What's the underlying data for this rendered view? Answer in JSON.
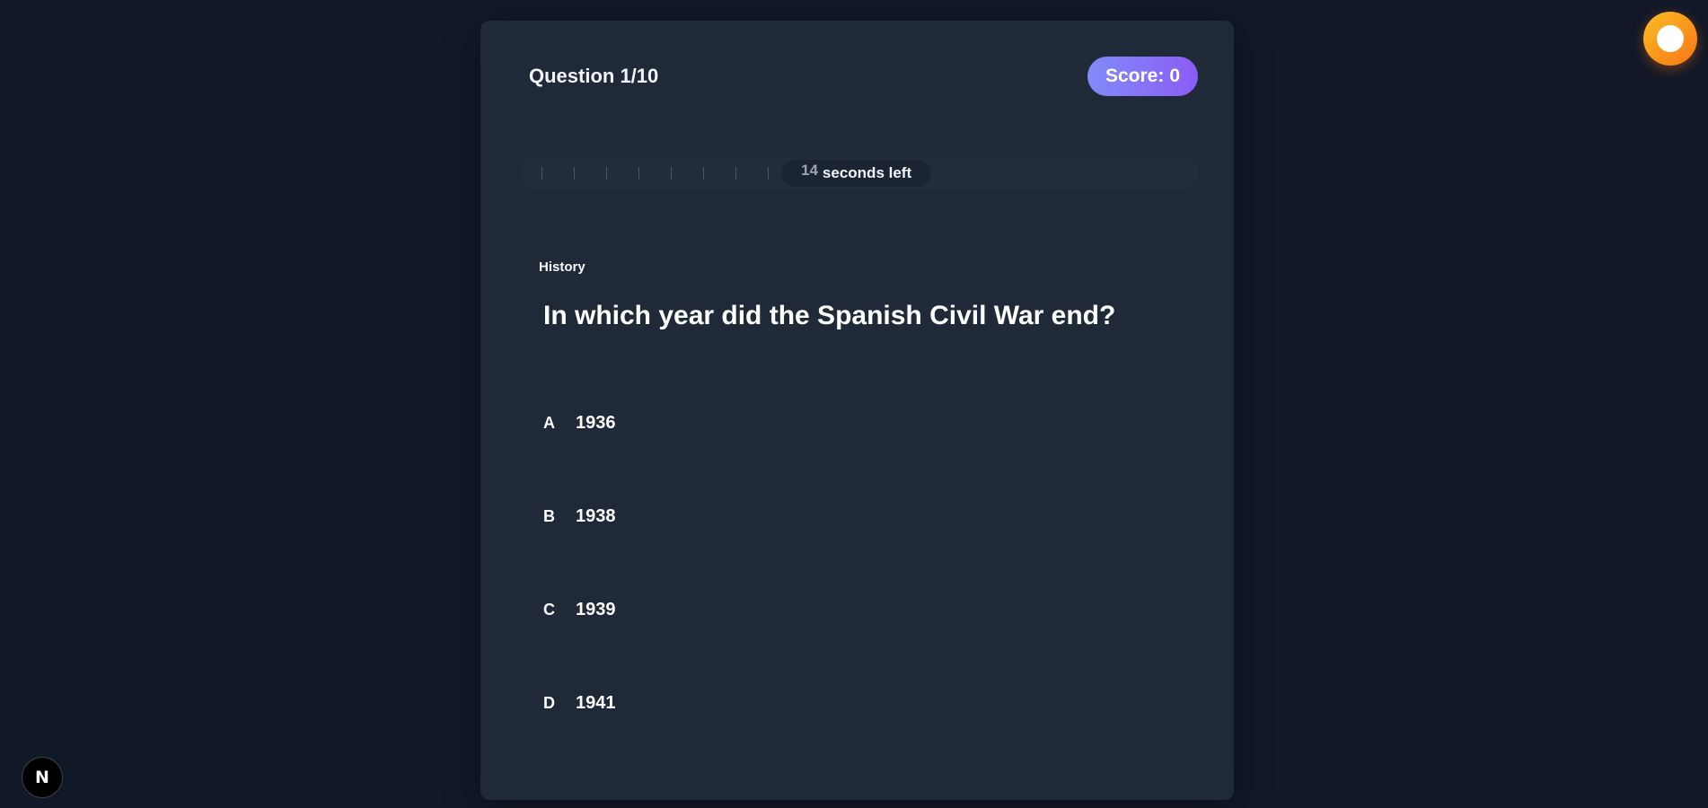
{
  "header": {
    "question_counter": "Question 1/10",
    "score_label": "Score:",
    "score_value": "0"
  },
  "timer": {
    "seconds": "14",
    "suffix": "seconds left"
  },
  "question": {
    "category": "History",
    "text": "In which year did the Spanish Civil War end?"
  },
  "answers": [
    {
      "letter": "A",
      "text": "1936"
    },
    {
      "letter": "B",
      "text": "1938"
    },
    {
      "letter": "C",
      "text": "1939"
    },
    {
      "letter": "D",
      "text": "1941"
    }
  ],
  "floating": {
    "nextjs_badge": "N",
    "theme_toggle_icon": "sun-toggle-icon"
  },
  "colors": {
    "background": "#111827",
    "card": "#1f2937",
    "score_gradient_start": "#818cf8",
    "score_gradient_end": "#8b5cf6",
    "toggle_start": "#fbbf24",
    "toggle_end": "#f97316"
  }
}
